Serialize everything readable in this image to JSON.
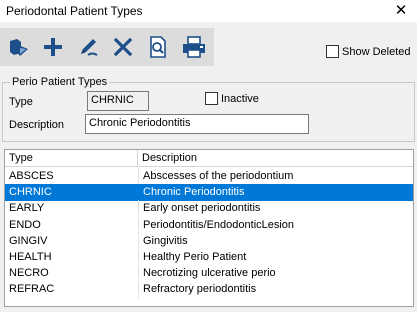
{
  "window": {
    "title": "Periodontal Patient Types",
    "close_glyph": "✕"
  },
  "toolbar": {
    "buttons": [
      {
        "name": "open-icon"
      },
      {
        "name": "add-icon"
      },
      {
        "name": "edit-icon"
      },
      {
        "name": "delete-icon"
      },
      {
        "name": "preview-icon"
      },
      {
        "name": "print-icon"
      }
    ],
    "accent": "#1e4f8a"
  },
  "show_deleted": {
    "label": "Show Deleted",
    "checked": false
  },
  "editor": {
    "group_caption": "Perio Patient Types",
    "type_label": "Type",
    "type_value": "CHRNIC",
    "inactive_label": "Inactive",
    "inactive_checked": false,
    "description_label": "Description",
    "description_value": "Chronic Periodontitis"
  },
  "grid": {
    "columns": [
      "Type",
      "Description"
    ],
    "rows": [
      {
        "type": "ABSCES",
        "description": "Abscesses of the periodontium",
        "selected": false
      },
      {
        "type": "CHRNIC",
        "description": "Chronic Periodontitis",
        "selected": true
      },
      {
        "type": "EARLY",
        "description": "Early onset periodontitis",
        "selected": false
      },
      {
        "type": "ENDO",
        "description": "Periodontitis/EndodonticLesion",
        "selected": false
      },
      {
        "type": "GINGIV",
        "description": "Gingivitis",
        "selected": false
      },
      {
        "type": "HEALTH",
        "description": "Healthy Perio Patient",
        "selected": false
      },
      {
        "type": "NECRO",
        "description": "Necrotizing ulcerative perio",
        "selected": false
      },
      {
        "type": "REFRAC",
        "description": "Refractory periodontitis",
        "selected": false
      }
    ],
    "selection_color": "#0078d7"
  }
}
